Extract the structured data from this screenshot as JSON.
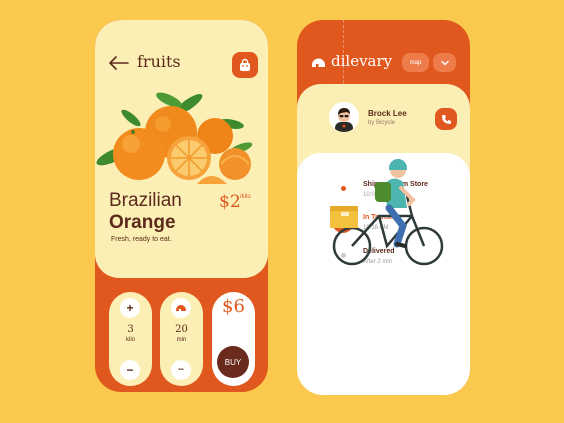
{
  "product_screen": {
    "title": "fruits",
    "product_name_line1": "Brazilian",
    "product_name_line2": "Orange",
    "price": "$2",
    "price_unit": "/kilo",
    "description": "Fresh, ready to eat.",
    "quantity": {
      "value": "3",
      "unit": "kilo",
      "plus": "+",
      "minus": "−"
    },
    "delivery_time": {
      "value": "20",
      "unit": "min",
      "more": "•••"
    },
    "total": "$6",
    "buy_label": "BUY"
  },
  "delivery_screen": {
    "brand": "dilevary",
    "map_label": "map",
    "courier": {
      "name": "Brock Lee",
      "transport": "by Bicycle"
    },
    "steps": [
      {
        "title": "Shipped from Store",
        "time": "10:00 AM",
        "state": "done"
      },
      {
        "title": "In Transit",
        "time": "10:18 AM",
        "state": "active"
      },
      {
        "title": "Delivered",
        "time": "After 2 min",
        "state": "pending"
      }
    ]
  },
  "colors": {
    "background": "#FBC94D",
    "accent": "#E1581E",
    "cream": "#FCEFB6",
    "text_dark": "#5B2A1A",
    "buy_button": "#6B2A1E"
  },
  "icons": [
    "back-arrow-icon",
    "shopping-bag-icon",
    "helmet-icon",
    "phone-icon",
    "chevron-down-icon",
    "arrow-right-icon",
    "dilevary-logo-icon"
  ]
}
